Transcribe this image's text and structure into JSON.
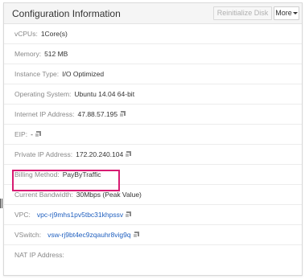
{
  "panel": {
    "title": "Configuration Information",
    "reinit_label": "Reinitialize Disk",
    "more_label": "More"
  },
  "rows": {
    "vcpus": {
      "label": "vCPUs:",
      "value": "1Core(s)"
    },
    "memory": {
      "label": "Memory:",
      "value": "512 MB"
    },
    "instance_type": {
      "label": "Instance Type:",
      "value": "I/O Optimized"
    },
    "os": {
      "label": "Operating System:",
      "value": "Ubuntu 14.04 64-bit"
    },
    "internet_ip": {
      "label": "Internet IP Address:",
      "value": "47.88.57.195"
    },
    "eip": {
      "label": "EIP:",
      "value": "-"
    },
    "private_ip": {
      "label": "Private IP Address:",
      "value": "172.20.240.104"
    },
    "billing": {
      "label": "Billing Method:",
      "value": "PayByTraffic"
    },
    "bandwidth": {
      "label": "Current Bandwidth:",
      "value": "30Mbps (Peak Value)"
    },
    "vpc": {
      "label": "VPC:",
      "value": "vpc-rj9mhs1pv5tbc31khpssv"
    },
    "vswitch": {
      "label": "VSwitch:",
      "value": "vsw-rj9bt4ec9zqauhr8vig9q"
    },
    "nat_ip": {
      "label": "NAT IP Address:",
      "value": ""
    }
  },
  "icons": {
    "copy": "copy-icon"
  },
  "colors": {
    "highlight": "#d81b72",
    "link": "#1f5fbf"
  }
}
